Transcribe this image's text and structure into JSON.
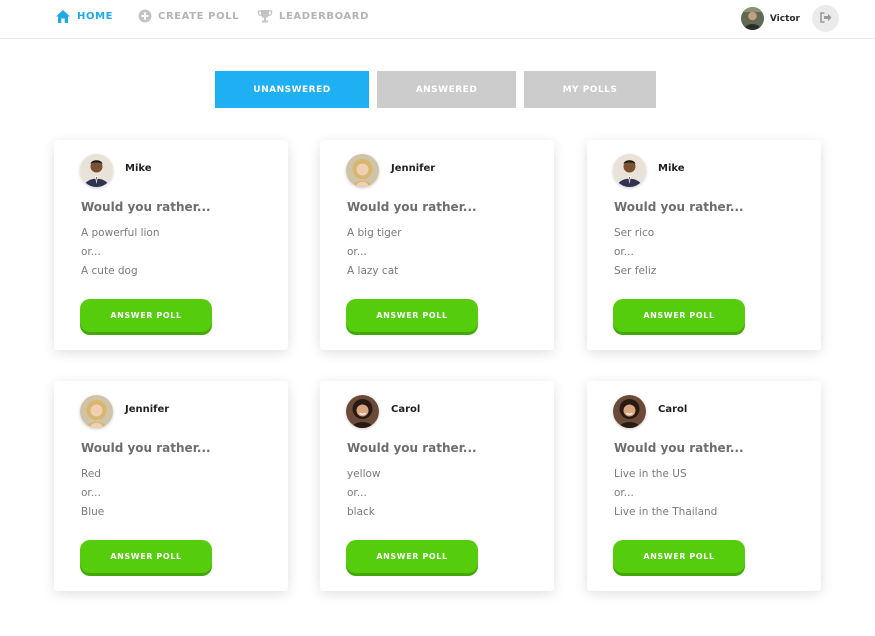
{
  "nav": {
    "home": "HOME",
    "create_poll": "CREATE POLL",
    "leaderboard": "LEADERBOARD"
  },
  "user": {
    "name": "Victor"
  },
  "tabs": [
    "UNANSWERED",
    "ANSWERED",
    "MY POLLS"
  ],
  "active_tab": "UNANSWERED",
  "colors": {
    "accent": "#1fb0f3",
    "tab_inactive": "#cccccc",
    "button": "#55cc0c"
  },
  "polls": [
    {
      "author": "Mike",
      "question": "Would you rather...",
      "option_a": "A powerful lion",
      "or": "or...",
      "option_b": "A cute dog",
      "button": "ANSWER POLL"
    },
    {
      "author": "Jennifer",
      "question": "Would you rather...",
      "option_a": "A big tiger",
      "or": "or...",
      "option_b": "A lazy cat",
      "button": "ANSWER POLL"
    },
    {
      "author": "Mike",
      "question": "Would you rather...",
      "option_a": "Ser rico",
      "or": "or...",
      "option_b": "Ser feliz",
      "button": "ANSWER POLL"
    },
    {
      "author": "Jennifer",
      "question": "Would you rather...",
      "option_a": "Red",
      "or": "or...",
      "option_b": "Blue",
      "button": "ANSWER POLL"
    },
    {
      "author": "Carol",
      "question": "Would you rather...",
      "option_a": "yellow",
      "or": "or...",
      "option_b": "black",
      "button": "ANSWER POLL"
    },
    {
      "author": "Carol",
      "question": "Would you rather...",
      "option_a": "Live in the US",
      "or": "or...",
      "option_b": "Live in the Thailand",
      "button": "ANSWER POLL"
    }
  ]
}
